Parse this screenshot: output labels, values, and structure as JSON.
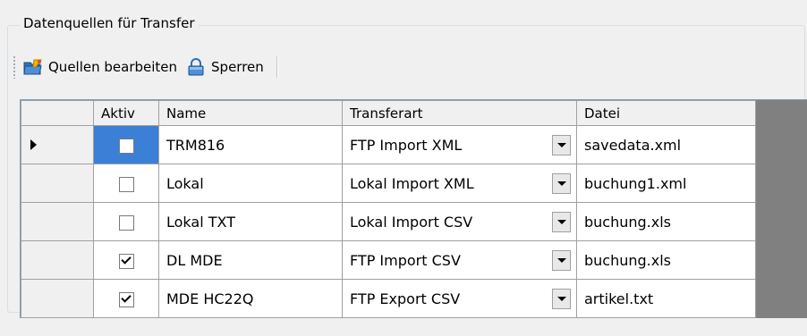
{
  "groupbox": {
    "title": "Datenquellen für Transfer"
  },
  "toolbar": {
    "edit_label": "Quellen bearbeiten",
    "lock_label": "Sperren"
  },
  "grid": {
    "columns": [
      "Aktiv",
      "Name",
      "Transferart",
      "Datei"
    ],
    "rows": [
      {
        "current": true,
        "aktiv": false,
        "name": "TRM816",
        "transferart": "FTP Import XML",
        "datei": "savedata.xml"
      },
      {
        "current": false,
        "aktiv": false,
        "name": "Lokal",
        "transferart": "Lokal Import XML",
        "datei": "buchung1.xml"
      },
      {
        "current": false,
        "aktiv": false,
        "name": "Lokal TXT",
        "transferart": "Lokal Import CSV",
        "datei": "buchung.xls"
      },
      {
        "current": false,
        "aktiv": true,
        "name": "DL MDE",
        "transferart": "FTP Import CSV",
        "datei": "buchung.xls"
      },
      {
        "current": false,
        "aktiv": true,
        "name": "MDE HC22Q",
        "transferart": "FTP Export CSV",
        "datei": "artikel.txt"
      }
    ]
  },
  "icons": {
    "edit": "folder-edit-icon",
    "lock": "lock-icon"
  }
}
